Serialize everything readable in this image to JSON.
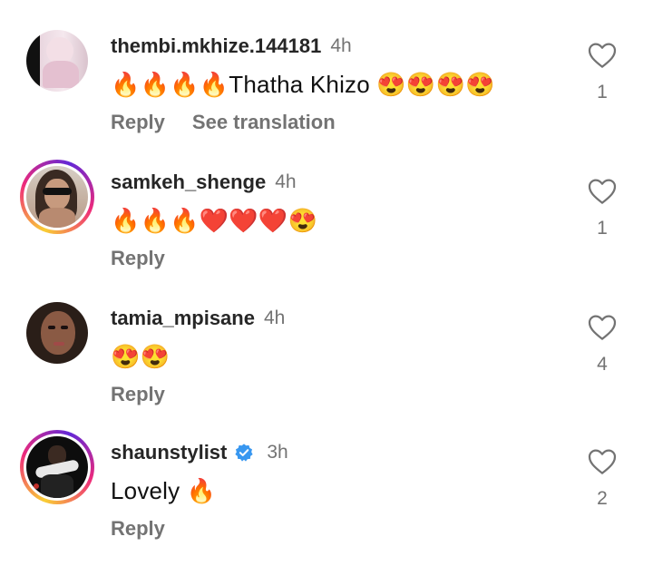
{
  "comments": [
    {
      "username": "thembi.mkhize.144181",
      "time": "4h",
      "text": "🔥🔥🔥🔥Thatha Khizo 😍😍😍😍",
      "reply": "Reply",
      "translate": "See translation",
      "likes": "1",
      "story_ring": false,
      "verified": false
    },
    {
      "username": "samkeh_shenge",
      "time": "4h",
      "text": "🔥🔥🔥❤️❤️❤️😍",
      "reply": "Reply",
      "likes": "1",
      "story_ring": true,
      "verified": false
    },
    {
      "username": "tamia_mpisane",
      "time": "4h",
      "text": "😍😍",
      "reply": "Reply",
      "likes": "4",
      "story_ring": false,
      "verified": false
    },
    {
      "username": "shaunstylist",
      "time": "3h",
      "text": "Lovely 🔥",
      "reply": "Reply",
      "likes": "2",
      "story_ring": true,
      "verified": true
    }
  ],
  "colors": {
    "username": "#262626",
    "secondary": "#737373",
    "verified": "#3897f0"
  },
  "icons": {
    "like": "heart-outline-icon",
    "verified": "verified-badge-icon"
  }
}
